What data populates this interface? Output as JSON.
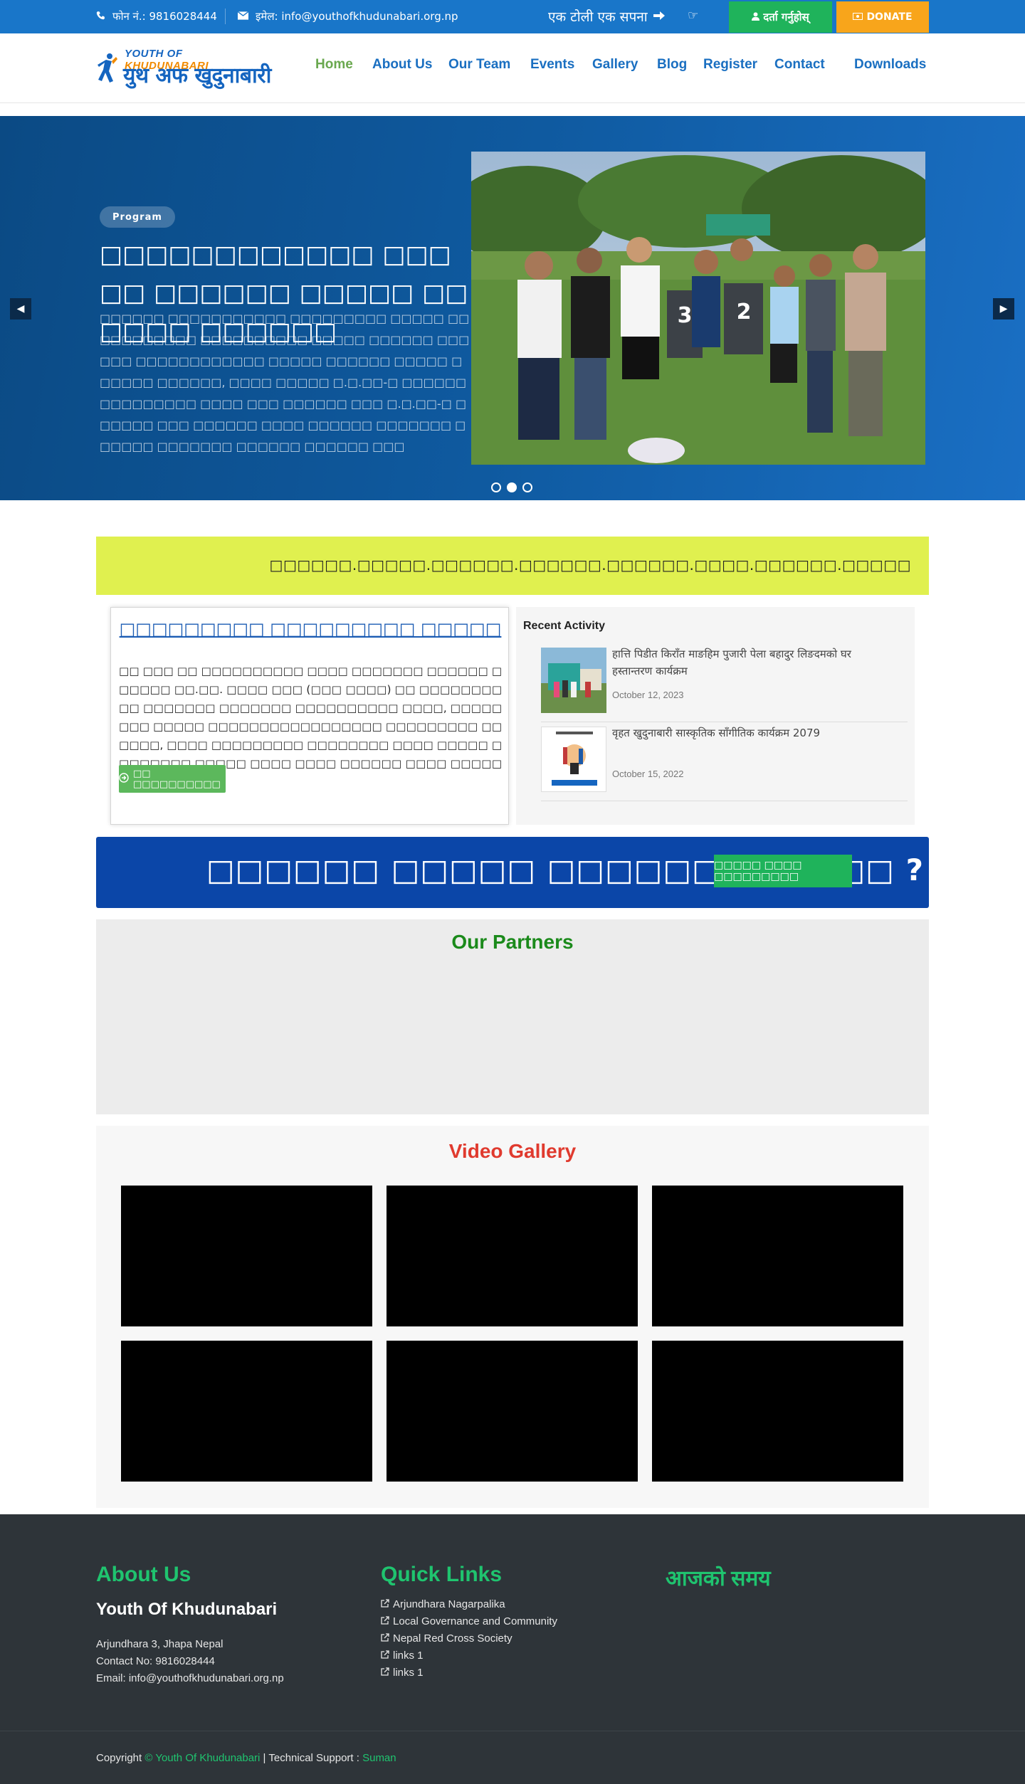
{
  "topbar": {
    "phone_label": "फोन नं.: 9816028444",
    "email_label": "इमेल: info@youthofkhudunabari.org.np",
    "slogan": "एक टोली एक सपना",
    "register_label": "दर्ता गर्नुहोस्",
    "donate_label": "DONATE",
    "colors": {
      "bar": "#1976c9",
      "register": "#1fb35b",
      "donate": "#f8a51b"
    }
  },
  "header": {
    "logo_top_a": "YOUTH OF ",
    "logo_top_b": "KHUDUNABARI",
    "logo_bottom": "युथ अफ खुदुनाबारी",
    "nav": [
      "Home",
      "About Us",
      "Our Team",
      "Events",
      "Gallery",
      "Blog",
      "Register",
      "Contact",
      "Downloads"
    ],
    "active_nav": "Home"
  },
  "hero": {
    "badge": "Program",
    "title": "□□□□□□□□□□□□ □□□□□ □□□□□□ □□□□□ □□□□□□ □□□□□□",
    "text": "□□□□□□ □□□□□□□□□□□ □□□□□□□□□ □□□□□ □□□□□□□□□□□ □□□□□□□□□□ □□□□□ □□□□□□ □□□□□□ □□□□□□□□□□□□ □□□□□ □□□□□□ □□□□□ □□□□□□ □□□□□□, □□□□ □□□□□ □.□.□□-□ □□□□□□ □□□□□□□□□ □□□□ □□□ □□□□□□ □□□ □.□.□□-□ □□□□□□ □□□ □□□□□□ □□□□ □□□□□□ □□□□□□□ □□□□□□ □□□□□□□ □□□□□□ □□□□□□ □□□",
    "slide_count": 3,
    "active_slide": 2
  },
  "marquee": {
    "text": "□□□□□□.□□□□□.□□□□□□.□□□□□□.□□□□□□.□□□□.□□□□□□.□□□□□"
  },
  "about": {
    "title": "□□□□□□□□□ □□□□□□□□□ □□□□□",
    "text": "□□ □□□ □□ □□□□□□□□□□ □□□□ □□□□□□□ □□□□□□ □□□□□□ □□.□□. □□□□ □□□ (□□□ □□□□) □□ □□□□□□□□ □□ □□□□□□□ □□□□□□□ □□□□□□□□□□ □□□□, □□□□□ □□□ □□□□□ □□□□□□□□□□□□□□□□□ □□□□□□□□□ □□□□□□, □□□□ □□□□□□□□□ □□□□□□□□ □□□□ □□□□□ □□□□□□□□ □□□□□ □□□□ □□□□ □□□□□□ □□□□ □□□□□□ □□ □",
    "button_label": "□□ □□□□□□□□□□"
  },
  "recent": {
    "heading": "Recent Activity",
    "items": [
      {
        "title": "हात्ति पिडीत किराँत माङहिम पुजारी पेला बहादुर लिङदमको घर हस्तान्तरण कार्यक्रम",
        "date": "October 12, 2023"
      },
      {
        "title": "वृहत खुदुनाबारी सास्कृतिक साँगीतिक कार्यक्रम 2079",
        "date": "October 15, 2022"
      }
    ]
  },
  "cta": {
    "text": "□□□□□□ □□□□□ □□□□□□□□□□□□ ?",
    "button_label": "□□□□□ □□□□ □□□□□□□□□"
  },
  "partners": {
    "title": "Our Partners"
  },
  "videos": {
    "title": "Video Gallery",
    "count": 6
  },
  "footer": {
    "about_heading": "About Us",
    "org_name": "Youth Of Khudunabari",
    "address": "Arjundhara 3, Jhapa Nepal",
    "contact": "Contact No: 9816028444",
    "email": "Email: info@youthofkhudunabari.org.np",
    "links_heading": "Quick Links",
    "links": [
      "Arjundhara Nagarpalika",
      "Local Governance and Community",
      "Nepal Red Cross Society",
      "links 1",
      "links 1"
    ],
    "time_heading": "आजको समय",
    "copyright_prefix": "Copyright ",
    "copyright_org": "© Youth Of Khudunabari",
    "support_prefix": " | Technical Support : ",
    "support_name": "Suman",
    "accent": "#1fc46f"
  }
}
